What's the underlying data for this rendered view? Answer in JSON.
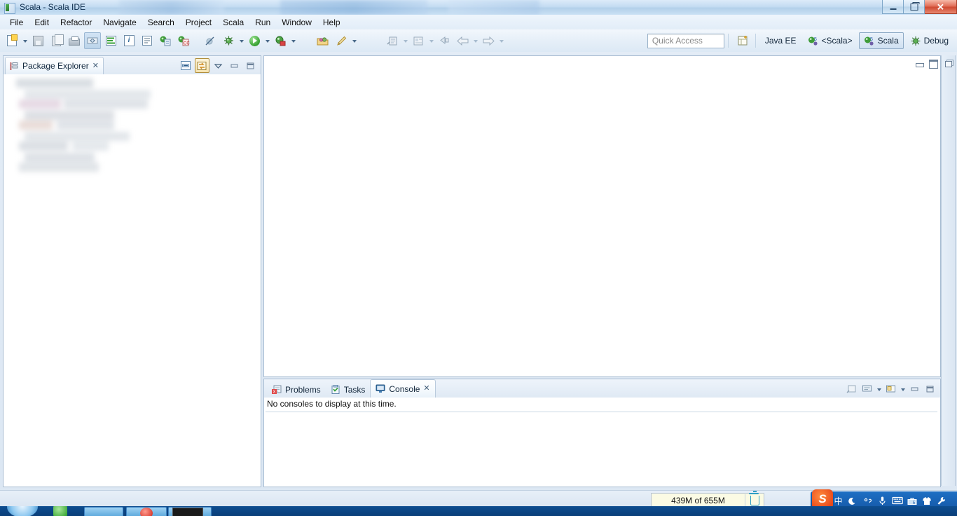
{
  "window": {
    "title": "Scala - Scala IDE",
    "minimize_label": "Minimize",
    "restore_label": "Restore",
    "close_label": "Close",
    "close_glyph": "✕"
  },
  "menubar": {
    "items": [
      {
        "label": "File"
      },
      {
        "label": "Edit"
      },
      {
        "label": "Refactor"
      },
      {
        "label": "Navigate"
      },
      {
        "label": "Search"
      },
      {
        "label": "Project"
      },
      {
        "label": "Scala"
      },
      {
        "label": "Run"
      },
      {
        "label": "Window"
      },
      {
        "label": "Help"
      }
    ]
  },
  "toolbar": {
    "buttons": [
      {
        "name": "new-wizard",
        "tooltip": "New"
      },
      {
        "name": "save",
        "tooltip": "Save"
      },
      {
        "name": "save-all",
        "tooltip": "Save All"
      },
      {
        "name": "print",
        "tooltip": "Print"
      },
      {
        "name": "toggle-markers",
        "tooltip": "Toggle Mark Occurrences"
      },
      {
        "name": "scala-console",
        "tooltip": "Scala Console"
      },
      {
        "name": "info",
        "tooltip": "Information"
      },
      {
        "name": "outline",
        "tooltip": "Outline"
      },
      {
        "name": "new-scala-project",
        "tooltip": "New Scala Project"
      },
      {
        "name": "new-scala-class",
        "tooltip": "New Scala Class"
      },
      {
        "name": "skip-breakpoints",
        "tooltip": "Skip All Breakpoints"
      },
      {
        "name": "debug",
        "tooltip": "Debug"
      },
      {
        "name": "run",
        "tooltip": "Run"
      },
      {
        "name": "coverage",
        "tooltip": "Coverage"
      },
      {
        "name": "open-package",
        "tooltip": "Open Package"
      },
      {
        "name": "external-tools",
        "tooltip": "External Tools"
      },
      {
        "name": "new-java-type",
        "tooltip": "New Java Type"
      },
      {
        "name": "open-type",
        "tooltip": "Open Type"
      },
      {
        "name": "last-edit",
        "tooltip": "Back to Last Edit Location"
      },
      {
        "name": "back",
        "tooltip": "Back"
      },
      {
        "name": "forward",
        "tooltip": "Forward"
      }
    ]
  },
  "quick_access": {
    "placeholder": "Quick Access",
    "value": ""
  },
  "perspectives": {
    "open_label": "Open Perspective",
    "items": [
      {
        "label": "Java EE",
        "icon": "java-ee-icon",
        "active": false
      },
      {
        "label": "<Scala>",
        "icon": "scala-icon",
        "active": false
      },
      {
        "label": "Scala",
        "icon": "scala-icon",
        "active": true
      },
      {
        "label": "Debug",
        "icon": "debug-icon",
        "active": false
      }
    ]
  },
  "package_explorer": {
    "tab_label": "Package Explorer",
    "close_glyph": "✕",
    "tools": [
      {
        "name": "collapse-all-button",
        "label": "Collapse All"
      },
      {
        "name": "link-with-editor-button",
        "label": "Link with Editor"
      },
      {
        "name": "view-menu-button",
        "label": "View Menu"
      },
      {
        "name": "minimize-button",
        "label": "Minimize"
      },
      {
        "name": "maximize-button",
        "label": "Maximize"
      }
    ]
  },
  "editor": {
    "tools": [
      {
        "name": "minimize-button",
        "label": "Minimize"
      },
      {
        "name": "maximize-button",
        "label": "Maximize"
      }
    ]
  },
  "right_trim": {
    "restore_label": "Restore"
  },
  "console_panel": {
    "tabs": [
      {
        "label": "Problems",
        "icon": "problems-icon",
        "active": false,
        "closable": false
      },
      {
        "label": "Tasks",
        "icon": "tasks-icon",
        "active": false,
        "closable": false
      },
      {
        "label": "Console",
        "icon": "console-icon",
        "active": true,
        "closable": true
      }
    ],
    "close_glyph": "✕",
    "message": "No consoles to display at this time.",
    "tools": [
      {
        "name": "pin-console-button",
        "label": "Pin Console"
      },
      {
        "name": "display-selected-console-button",
        "label": "Display Selected Console"
      },
      {
        "name": "open-console-button",
        "label": "Open Console"
      },
      {
        "name": "minimize-button",
        "label": "Minimize"
      },
      {
        "name": "maximize-button",
        "label": "Maximize"
      }
    ]
  },
  "status_bar": {
    "heap_text": "439M of 655M",
    "gc_label": "Run Garbage Collector"
  },
  "ime_tray": {
    "logo_text": "S",
    "buttons": [
      {
        "name": "chinese-mode-icon",
        "glyph": "中"
      },
      {
        "name": "moon-icon",
        "glyph": "☽"
      },
      {
        "name": "punctuation-icon",
        "glyph": "°,"
      },
      {
        "name": "microphone-icon",
        "glyph": "🎤"
      },
      {
        "name": "keyboard-icon",
        "glyph": "⌨"
      },
      {
        "name": "toolbox-icon",
        "glyph": "🧰"
      },
      {
        "name": "skin-icon",
        "glyph": "👕"
      },
      {
        "name": "settings-icon",
        "glyph": "🔧"
      }
    ]
  },
  "colors": {
    "accent": "#1e6fc4",
    "active_tab": "#ffffff",
    "heap_bg": "#fbfbe4",
    "panel_border": "#a7bcd2"
  }
}
